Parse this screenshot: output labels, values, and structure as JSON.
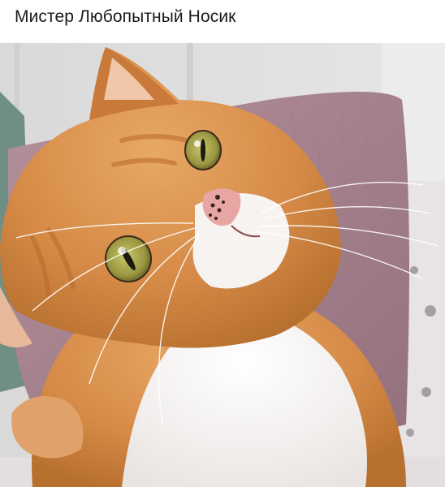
{
  "post": {
    "caption": "Мистер Любопытный Носик"
  },
  "photo": {
    "subject_icon": "cat-photo",
    "colors": {
      "fur_orange": "#d98f4a",
      "fur_white": "#f6f2ef",
      "eye_green": "#a9a24a",
      "nose_pink": "#e7a6a3",
      "pillow_mauve": "#a6808a",
      "pillow_teal": "#6f8f85",
      "wall_grey": "#dcdcdc"
    }
  }
}
